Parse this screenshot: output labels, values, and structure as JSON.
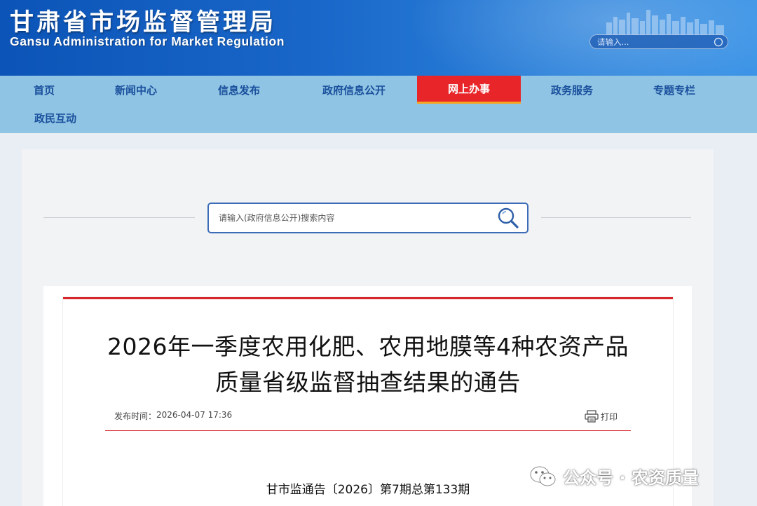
{
  "header": {
    "logo_cn": "甘肃省市场监督管理局",
    "logo_en": "Gansu Administration for Market Regulation",
    "search_placeholder": "请输入..."
  },
  "nav": {
    "items": [
      {
        "label": "首页"
      },
      {
        "label": "新闻中心"
      },
      {
        "label": "信息发布"
      },
      {
        "label": "政府信息公开"
      },
      {
        "label": "网上办事",
        "active": true
      },
      {
        "label": "政务服务"
      },
      {
        "label": "专题专栏"
      },
      {
        "label": "政民互动"
      }
    ],
    "active_color": "#e8262a",
    "text_color": "#1a4f9c"
  },
  "gov_search": {
    "placeholder": "请输入(政府信息公开)搜索内容",
    "icon": "magnifier-icon"
  },
  "article": {
    "title_line1": "2026年一季度农用化肥、农用地膜等4种农资产品",
    "title_line2": "质量省级监督抽查结果的通告",
    "publish_label": "发布时间：",
    "publish_time": "2026-04-07 17:36",
    "print_label": "打印",
    "doc_number": "甘市监通告〔2026〕第7期总第133期",
    "accent_color": "#d6262b"
  },
  "watermark": {
    "text": "公众号 · 农资质量",
    "icon": "wechat-icon"
  }
}
